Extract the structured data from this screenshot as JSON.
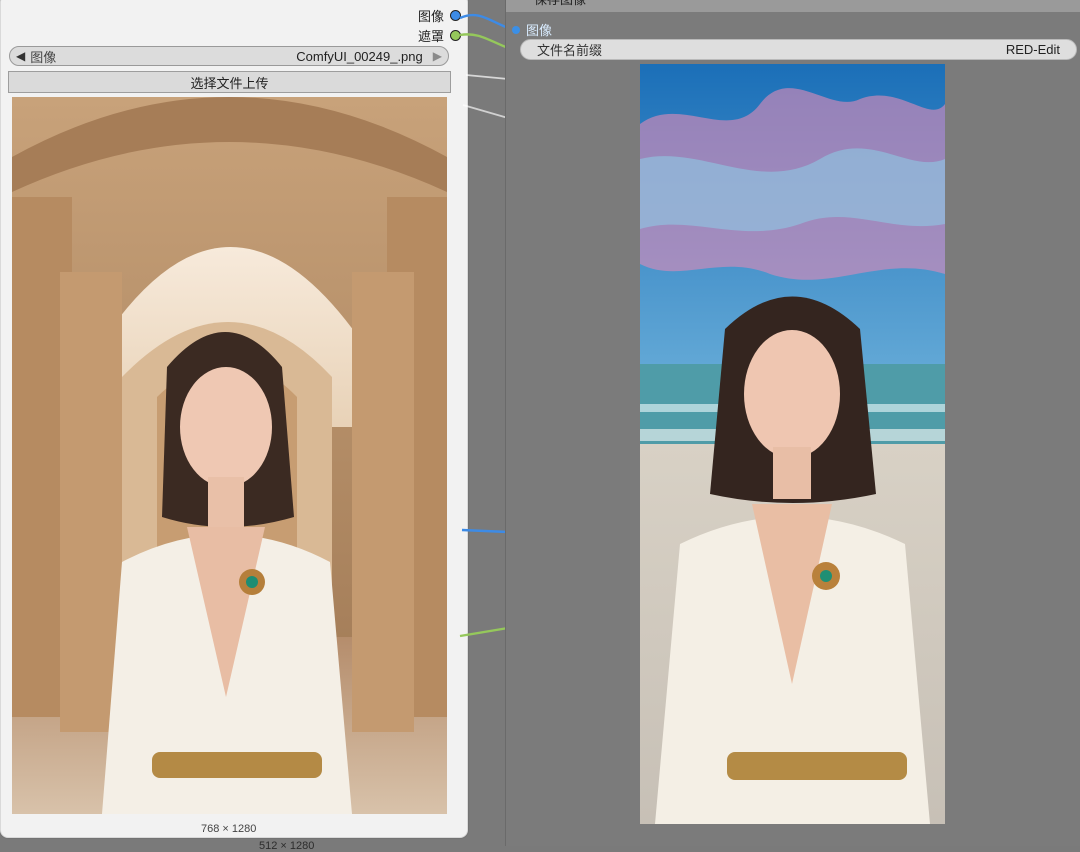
{
  "left_node": {
    "outputs": [
      {
        "label": "图像",
        "color": "#3d8be6"
      },
      {
        "label": "遮罩",
        "color": "#95c85b"
      }
    ],
    "file_widget": {
      "label": "图像",
      "value": "ComfyUI_00249_.png",
      "prev_arrow": "◀",
      "next_arrow": "▶"
    },
    "upload_button": "选择文件上传",
    "image": {
      "dimensions": "768 × 1280",
      "description_icon": "image-preview"
    }
  },
  "right_node": {
    "title": "保存图像",
    "input": {
      "label": "图像",
      "color": "#3b8fe6"
    },
    "filename_prefix": {
      "label": "文件名前缀",
      "value": "RED-Edit"
    },
    "image": {
      "dimensions": "512 × 1280"
    }
  },
  "colors": {
    "canvas_bg": "#7a7a7a",
    "node_bg": "#f2f2f2",
    "link_blue": "#3d8be6",
    "link_green": "#95c85b"
  }
}
